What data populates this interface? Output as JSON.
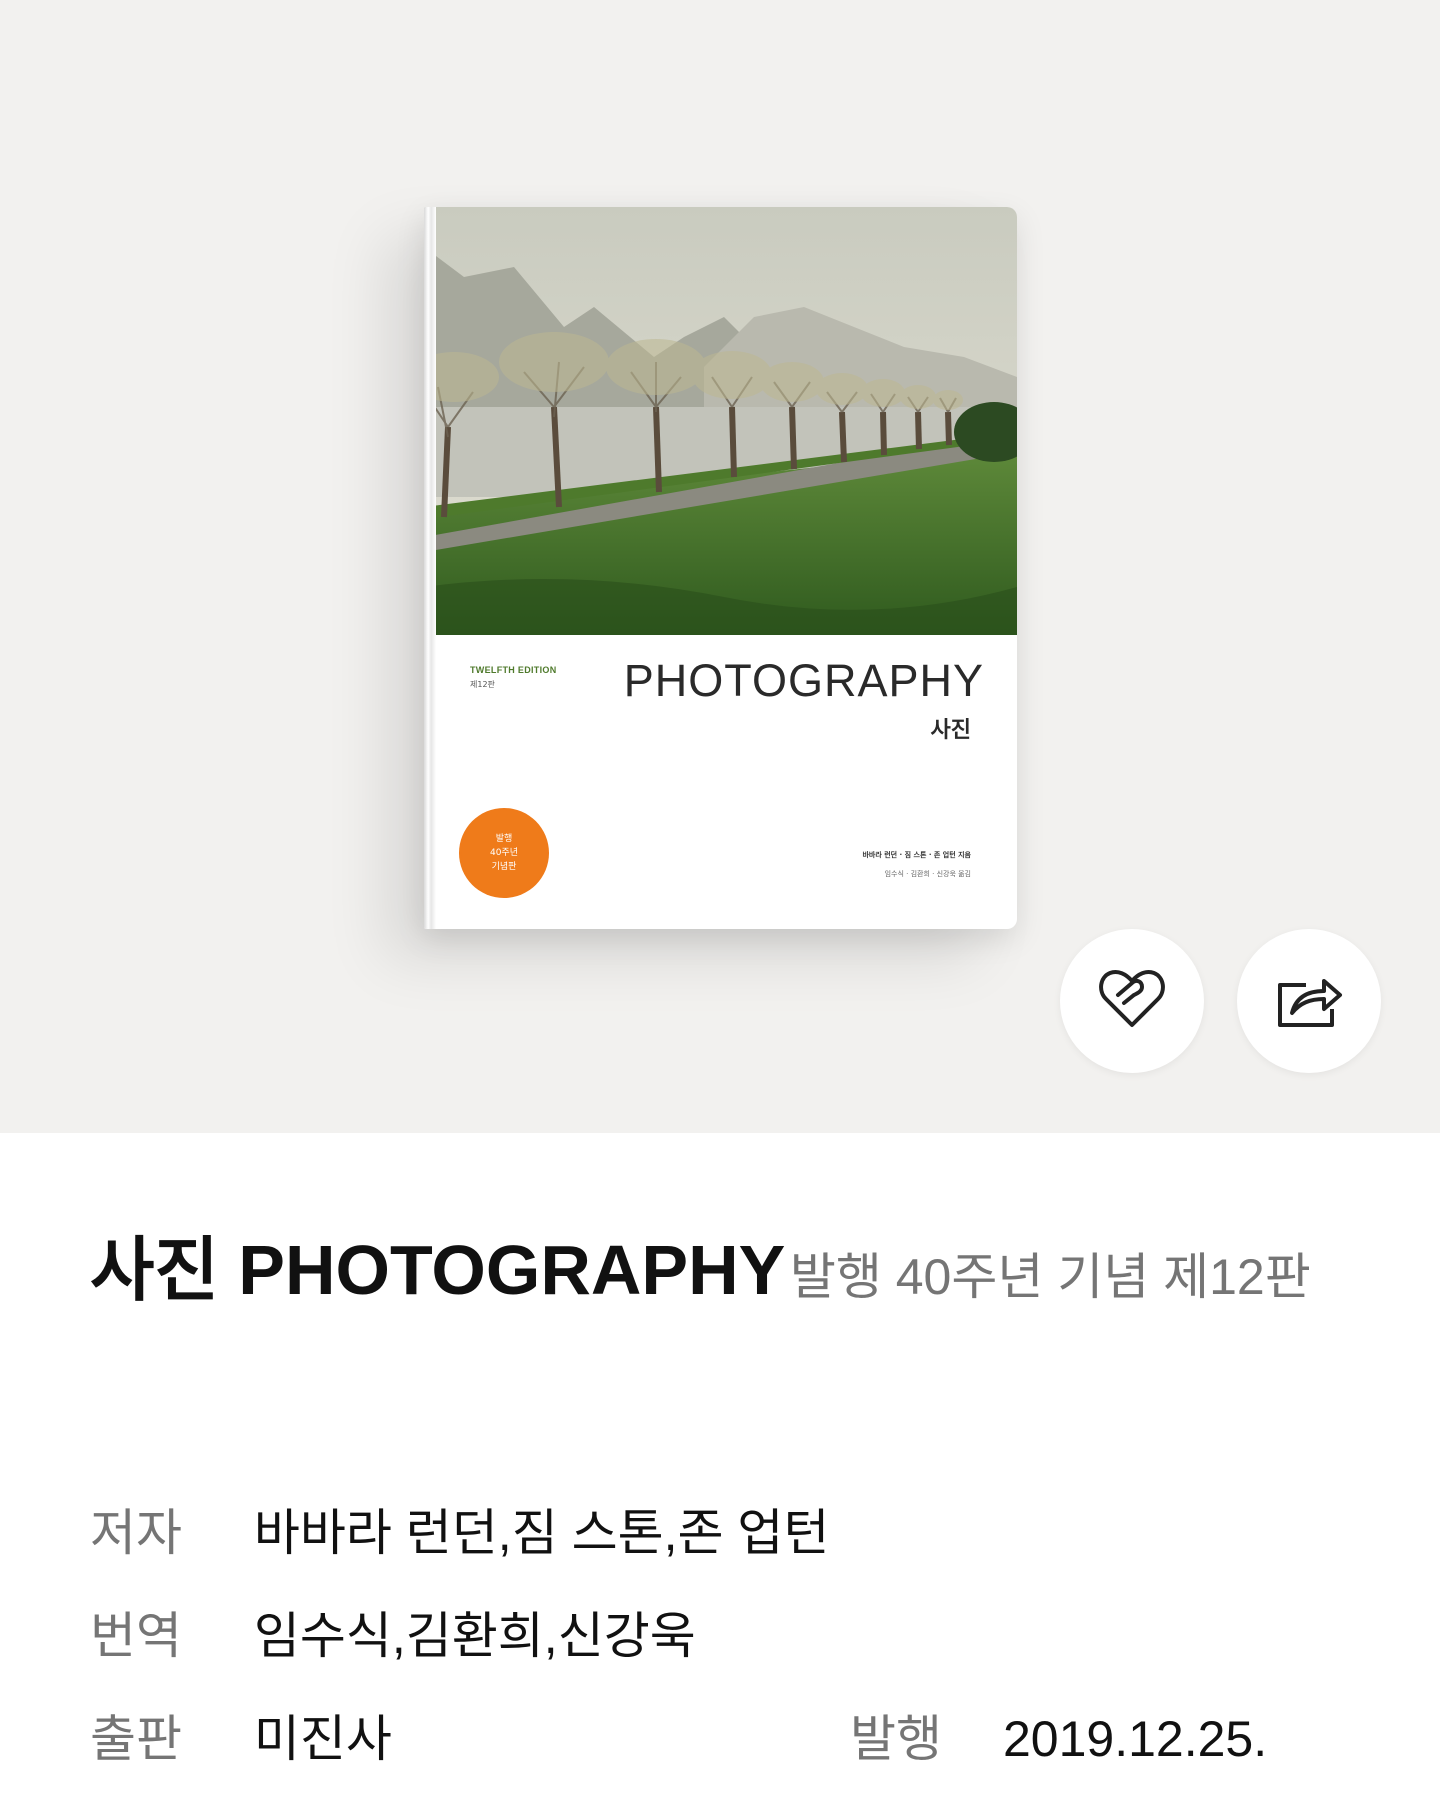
{
  "cover": {
    "edition_en": "TWELFTH EDITION",
    "edition_kr": "제12판",
    "title_en": "PHOTOGRAPHY",
    "title_kr": "사진",
    "badge_line1": "발행",
    "badge_line2": "40주년",
    "badge_line3": "기념판",
    "authors": "바바라 런던 · 짐 스톤 · 존 업턴 지음",
    "translators": "임수식 · 김환희 · 신강욱 옮김"
  },
  "actions": {
    "like_icon": "heart-icon",
    "share_icon": "share-icon"
  },
  "book": {
    "title": "사진 PHOTOGRAPHY",
    "subtitle": "발행 40주년 기념 제12판",
    "author_label": "저자",
    "authors": "바바라 런던,짐 스톤,존 업턴",
    "translator_label": "번역",
    "translators": "임수식,김환희,신강욱",
    "publisher_label": "출판",
    "publisher": "미진사",
    "date_label": "발행",
    "date": "2019.12.25."
  }
}
